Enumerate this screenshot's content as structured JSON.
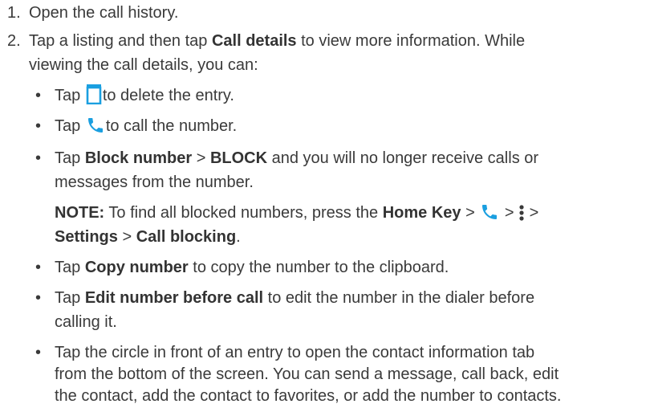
{
  "steps": [
    {
      "number": "1.",
      "text": "Open the call history."
    },
    {
      "number": "2.",
      "line1": {
        "pre": "Tap a listing and then tap ",
        "bold": "Call details",
        "post": " to view more information. While"
      },
      "line2": "viewing the call details, you can:"
    }
  ],
  "bullet_char": "•",
  "bullets": {
    "delete": {
      "pre": "Tap ",
      "icon": "trash-icon",
      "post": "to delete the entry."
    },
    "call": {
      "pre": "Tap ",
      "icon": "phone-icon",
      "post": "to call the number."
    },
    "block": {
      "pre": "Tap ",
      "bold1": "Block number",
      "mid": " > ",
      "bold2": "BLOCK",
      "post": " and you will no longer receive calls or",
      "line2": "messages from the number."
    },
    "note": {
      "label": "NOTE:",
      "pre": " To find all blocked numbers, press the ",
      "home": "Home Key",
      "sep1": " > ",
      "phone_icon": "phone-icon",
      "sep2": " > ",
      "menu_icon": "more-vert-icon",
      "sep3": " >",
      "settings": "Settings",
      "sep4": " > ",
      "call_blocking": "Call blocking",
      "end": "."
    },
    "copy": {
      "pre": "Tap ",
      "bold": "Copy number",
      "post": " to copy the number to the clipboard."
    },
    "edit": {
      "pre": "Tap ",
      "bold": "Edit number before call",
      "post": " to edit the number in the dialer before",
      "line2": "calling it."
    },
    "circle": {
      "line1": "Tap the circle in front of an entry to open the contact information tab",
      "line2": "from the bottom of the screen. You can send a message, call back, edit",
      "line3": "the contact, add the contact to favorites, or add the number to contacts."
    }
  },
  "colors": {
    "text": "#3a3a3a",
    "icon": "#1a9fe0"
  }
}
